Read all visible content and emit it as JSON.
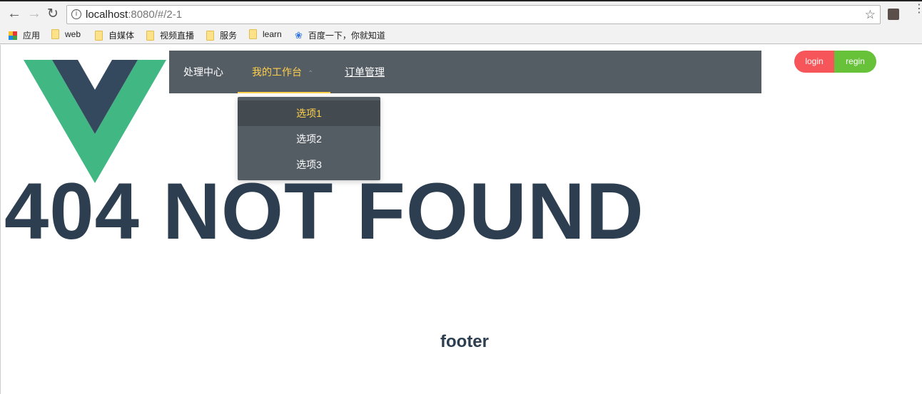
{
  "browser": {
    "url_host": "localhost",
    "url_rest": ":8080/#/2-1",
    "bookmarks": [
      {
        "label": "应用",
        "icon": "apps-icon"
      },
      {
        "label": "web",
        "icon": "folder-icon"
      },
      {
        "label": "自媒体",
        "icon": "folder-icon"
      },
      {
        "label": "视频直播",
        "icon": "folder-icon"
      },
      {
        "label": "服务",
        "icon": "folder-icon"
      },
      {
        "label": "learn",
        "icon": "folder-icon"
      },
      {
        "label": "百度一下，你就知道",
        "icon": "baidu-paw-icon"
      }
    ]
  },
  "nav": {
    "items": [
      {
        "label": "处理中心"
      },
      {
        "label": "我的工作台",
        "active": true
      },
      {
        "label": "订单管理"
      }
    ],
    "submenu": [
      {
        "label": "选项1",
        "selected": true
      },
      {
        "label": "选项2"
      },
      {
        "label": "选项3"
      }
    ],
    "colors": {
      "background": "#545c64",
      "active": "#ffd04b"
    }
  },
  "auth": {
    "login": "login",
    "regin": "regin"
  },
  "main": {
    "title": "404 NOT FOUND",
    "footer": "footer"
  }
}
